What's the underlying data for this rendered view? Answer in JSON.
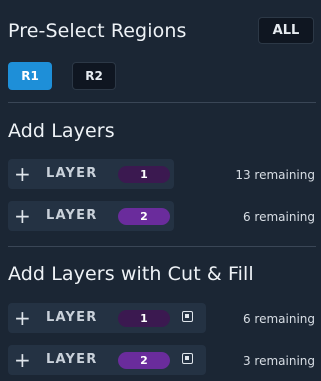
{
  "preselect": {
    "title": "Pre-Select Regions",
    "all_label": "ALL",
    "regions": [
      "R1",
      "R2"
    ],
    "active_region": "R1"
  },
  "add_layers": {
    "title": "Add Layers",
    "rows": [
      {
        "plus": "+",
        "label": "LAYER",
        "number": "1",
        "remaining": "13 remaining"
      },
      {
        "plus": "+",
        "label": "LAYER",
        "number": "2",
        "remaining": "6 remaining"
      }
    ]
  },
  "cut_fill": {
    "title": "Add Layers with Cut & Fill",
    "rows": [
      {
        "plus": "+",
        "label": "LAYER",
        "number": "1",
        "icon": "record-box-icon",
        "remaining": "6 remaining"
      },
      {
        "plus": "+",
        "label": "LAYER",
        "number": "2",
        "icon": "record-box-icon",
        "remaining": "3 remaining"
      }
    ]
  },
  "colors": {
    "background": "#1b2634",
    "active_region": "#1e8fd8",
    "layer1_pill": "#3b1950",
    "layer2_pill": "#6a2c9c"
  }
}
